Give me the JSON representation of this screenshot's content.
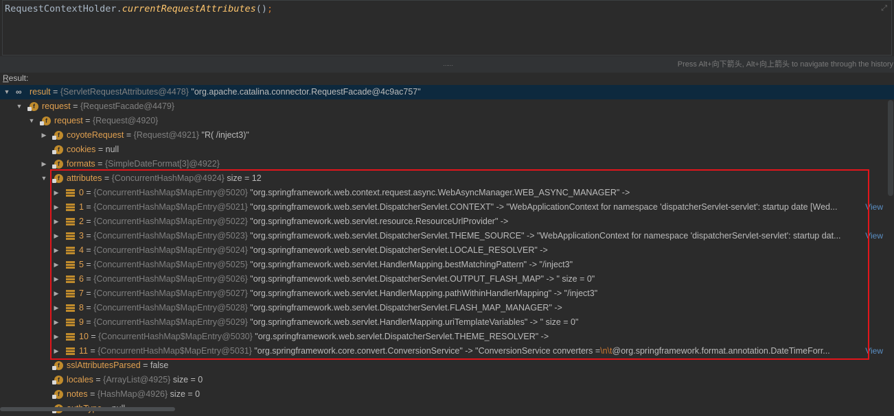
{
  "editor": {
    "class_name": "RequestContextHolder",
    "dot": ".",
    "method": "currentRequestAttributes",
    "parens": "()",
    "semicolon": ";",
    "expand_icon": "expand-diagonal-icon"
  },
  "hint": "Press Alt+向下箭头, Alt+向上箭头 to navigate through the history",
  "result_label": "Result:",
  "result_label_mnemonic": "R",
  "result_label_rest": "esult:",
  "colors": {
    "background": "#2b2b2b",
    "selection": "#0d293e",
    "field_name": "#e0a050",
    "type_text": "#808080",
    "highlight_box": "#e3151b",
    "link": "#5a8fc4"
  },
  "tree": [
    {
      "icon": "infinity-watch-icon",
      "name": "result",
      "eq": " = ",
      "type": "{ServletRequestAttributes@4478}",
      "value": " \"org.apache.catalina.connector.RequestFacade@4c9ac757\"",
      "arrow": "expanded"
    },
    {
      "icon": "field-icon",
      "name": "request",
      "eq": " = ",
      "type": "{RequestFacade@4479}",
      "value": "",
      "arrow": "expanded"
    },
    {
      "icon": "field-icon",
      "name": "request",
      "eq": " = ",
      "type": "{Request@4920}",
      "value": "",
      "arrow": "expanded"
    },
    {
      "icon": "field-icon",
      "name": "coyoteRequest",
      "eq": " = ",
      "type": "{Request@4921}",
      "value": " \"R( /inject3)\"",
      "arrow": "collapsed"
    },
    {
      "icon": "field-icon",
      "name": "cookies",
      "eq": " = ",
      "type": "",
      "value": "null",
      "arrow": "none"
    },
    {
      "icon": "field-icon",
      "name": "formats",
      "eq": " = ",
      "type": "{SimpleDateFormat[3]@4922}",
      "value": "",
      "arrow": "collapsed"
    },
    {
      "icon": "field-icon",
      "name": "attributes",
      "eq": " = ",
      "type": "{ConcurrentHashMap@4924}",
      "value": "  size = 12",
      "arrow": "expanded"
    },
    {
      "icon": "map-entry-icon",
      "name": "0",
      "eq": " = ",
      "type": "{ConcurrentHashMap$MapEntry@5020}",
      "value": " \"org.springframework.web.context.request.async.WebAsyncManager.WEB_ASYNC_MANAGER\" ->",
      "arrow": "collapsed"
    },
    {
      "icon": "map-entry-icon",
      "name": "1",
      "eq": " = ",
      "type": "{ConcurrentHashMap$MapEntry@5021}",
      "value": " \"org.springframework.web.servlet.DispatcherServlet.CONTEXT\" -> \"WebApplicationContext for namespace 'dispatcherServlet-servlet': startup date [Wed...",
      "arrow": "collapsed",
      "link": "View"
    },
    {
      "icon": "map-entry-icon",
      "name": "2",
      "eq": " = ",
      "type": "{ConcurrentHashMap$MapEntry@5022}",
      "value": " \"org.springframework.web.servlet.resource.ResourceUrlProvider\" ->",
      "arrow": "collapsed"
    },
    {
      "icon": "map-entry-icon",
      "name": "3",
      "eq": " = ",
      "type": "{ConcurrentHashMap$MapEntry@5023}",
      "value": " \"org.springframework.web.servlet.DispatcherServlet.THEME_SOURCE\" -> \"WebApplicationContext for namespace 'dispatcherServlet-servlet': startup dat...",
      "arrow": "collapsed",
      "link": "View"
    },
    {
      "icon": "map-entry-icon",
      "name": "4",
      "eq": " = ",
      "type": "{ConcurrentHashMap$MapEntry@5024}",
      "value": " \"org.springframework.web.servlet.DispatcherServlet.LOCALE_RESOLVER\" ->",
      "arrow": "collapsed"
    },
    {
      "icon": "map-entry-icon",
      "name": "5",
      "eq": " = ",
      "type": "{ConcurrentHashMap$MapEntry@5025}",
      "value": " \"org.springframework.web.servlet.HandlerMapping.bestMatchingPattern\" -> \"/inject3\"",
      "arrow": "collapsed"
    },
    {
      "icon": "map-entry-icon",
      "name": "6",
      "eq": " = ",
      "type": "{ConcurrentHashMap$MapEntry@5026}",
      "value": " \"org.springframework.web.servlet.DispatcherServlet.OUTPUT_FLASH_MAP\" -> \" size = 0\"",
      "arrow": "collapsed"
    },
    {
      "icon": "map-entry-icon",
      "name": "7",
      "eq": " = ",
      "type": "{ConcurrentHashMap$MapEntry@5027}",
      "value": " \"org.springframework.web.servlet.HandlerMapping.pathWithinHandlerMapping\" -> \"/inject3\"",
      "arrow": "collapsed"
    },
    {
      "icon": "map-entry-icon",
      "name": "8",
      "eq": " = ",
      "type": "{ConcurrentHashMap$MapEntry@5028}",
      "value": " \"org.springframework.web.servlet.DispatcherServlet.FLASH_MAP_MANAGER\" ->",
      "arrow": "collapsed"
    },
    {
      "icon": "map-entry-icon",
      "name": "9",
      "eq": " = ",
      "type": "{ConcurrentHashMap$MapEntry@5029}",
      "value": " \"org.springframework.web.servlet.HandlerMapping.uriTemplateVariables\" -> \" size = 0\"",
      "arrow": "collapsed"
    },
    {
      "icon": "map-entry-icon",
      "name": "10",
      "eq": " = ",
      "type": "{ConcurrentHashMap$MapEntry@5030}",
      "value": " \"org.springframework.web.servlet.DispatcherServlet.THEME_RESOLVER\" ->",
      "arrow": "collapsed"
    },
    {
      "icon": "map-entry-icon",
      "name": "11",
      "eq": " = ",
      "type": "{ConcurrentHashMap$MapEntry@5031}",
      "value": " \"org.springframework.core.convert.ConversionService\" -> \"ConversionService converters =",
      "esc": "\\n\\t",
      "value2": "@org.springframework.format.annotation.DateTimeForr...",
      "arrow": "collapsed",
      "link": "View"
    },
    {
      "icon": "field-icon",
      "name": "sslAttributesParsed",
      "eq": " = ",
      "type": "",
      "value": "false",
      "arrow": "none"
    },
    {
      "icon": "field-icon",
      "name": "locales",
      "eq": " = ",
      "type": "{ArrayList@4925}",
      "value": "  size = 0",
      "arrow": "none"
    },
    {
      "icon": "field-icon",
      "name": "notes",
      "eq": " = ",
      "type": "{HashMap@4926}",
      "value": "  size = 0",
      "arrow": "none"
    },
    {
      "icon": "field-icon",
      "name": "authType",
      "eq": " = ",
      "type": "",
      "value": "null",
      "arrow": "none"
    }
  ]
}
